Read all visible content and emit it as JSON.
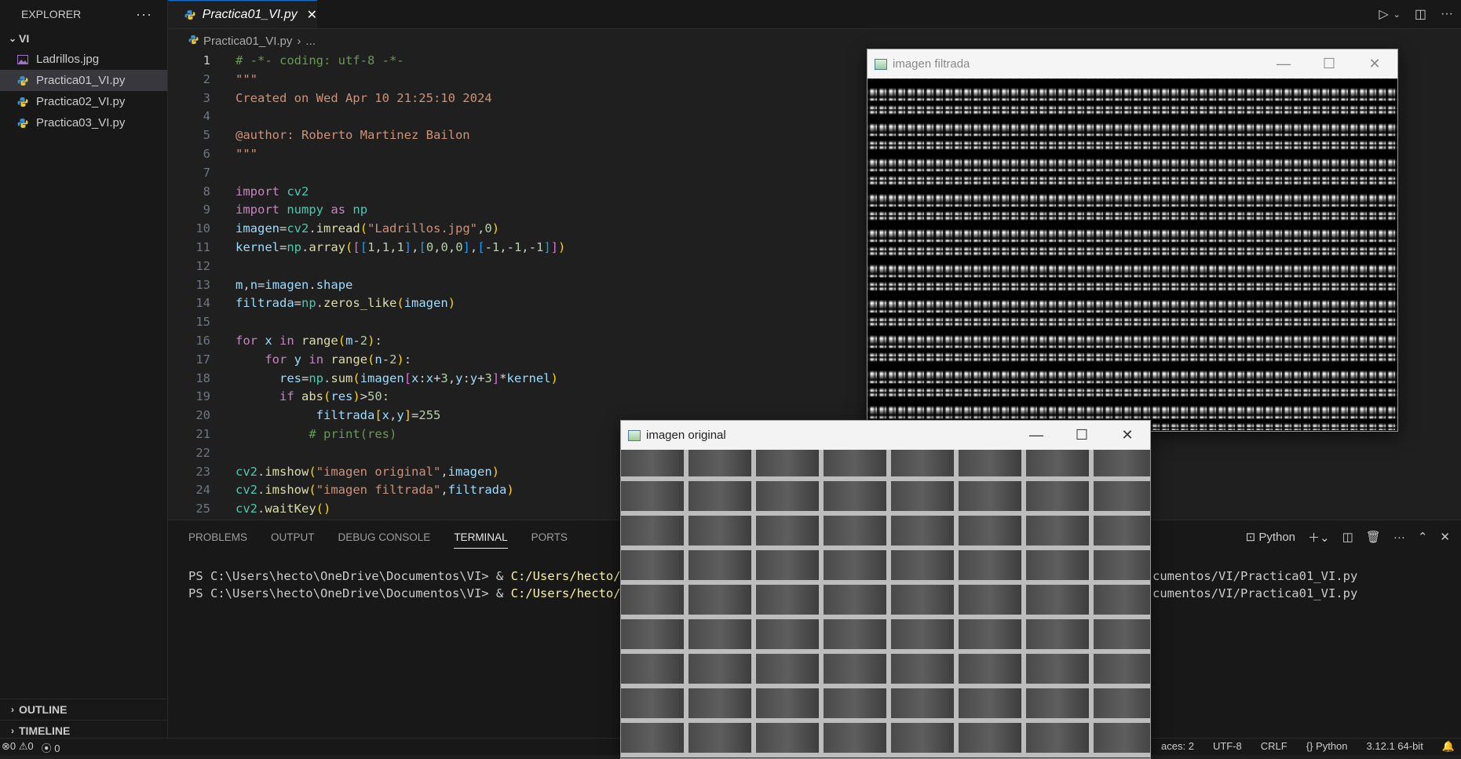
{
  "explorer": {
    "title": "EXPLORER",
    "folder": "VI",
    "files": [
      {
        "name": "Ladrillos.jpg",
        "icon": "image-icon"
      },
      {
        "name": "Practica01_VI.py",
        "icon": "python-icon"
      },
      {
        "name": "Practica02_VI.py",
        "icon": "python-icon"
      },
      {
        "name": "Practica03_VI.py",
        "icon": "python-icon"
      }
    ],
    "outline": "OUTLINE",
    "timeline": "TIMELINE"
  },
  "editor": {
    "tab": "Practica01_VI.py",
    "breadcrumb_file": "Practica01_VI.py",
    "breadcrumb_more": "...",
    "line_numbers": [
      "1",
      "2",
      "3",
      "4",
      "5",
      "6",
      "7",
      "8",
      "9",
      "10",
      "11",
      "12",
      "13",
      "14",
      "15",
      "16",
      "17",
      "18",
      "19",
      "20",
      "21",
      "22",
      "23",
      "24",
      "25"
    ]
  },
  "panel": {
    "tabs": [
      "PROBLEMS",
      "OUTPUT",
      "DEBUG CONSOLE",
      "TERMINAL",
      "PORTS"
    ],
    "active_tab": "TERMINAL",
    "shell_label": "Python",
    "terminal_lines": [
      {
        "prompt": "PS C:\\Users\\hecto\\OneDrive\\Documentos\\VI> & ",
        "cmd": "C:/Users/hecto/Ap",
        "tail": "cumentos/VI/Practica01_VI.py"
      },
      {
        "prompt": "PS C:\\Users\\hecto\\OneDrive\\Documentos\\VI> & ",
        "cmd": "C:/Users/hecto/Ap",
        "tail": "cumentos/VI/Practica01_VI.py"
      }
    ]
  },
  "statusbar": {
    "errors": "0",
    "warnings": "0",
    "ports": "0",
    "spaces": "aces: 2",
    "encoding": "UTF-8",
    "eol": "CRLF",
    "language": "Python",
    "interpreter": "3.12.1 64-bit"
  },
  "windows": {
    "filtered_title": "imagen filtrada",
    "original_title": "imagen original"
  },
  "colors": {
    "accent": "#0078d4",
    "editor_bg": "#1f1f1f",
    "sidebar_bg": "#181818"
  }
}
